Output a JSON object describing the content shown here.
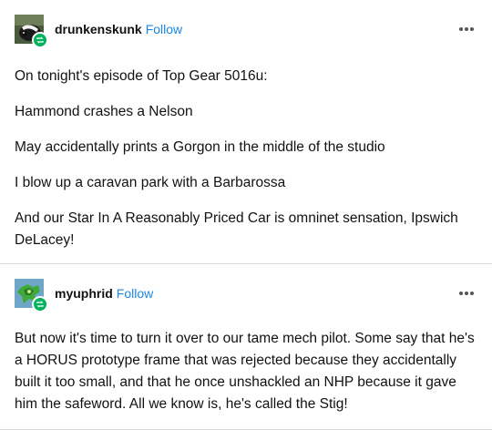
{
  "posts": [
    {
      "username": "drunkenskunk",
      "follow_label": "Follow",
      "avatar_icon": "skunk-avatar",
      "badge_icon": "reblog-icon",
      "more_icon": "more-options-icon",
      "paragraphs": [
        "On tonight's episode of Top Gear 5016u:",
        "Hammond crashes a Nelson",
        "May accidentally prints a Gorgon in the middle of the studio",
        "I blow up a caravan park with a Barbarossa",
        "And our Star In A Reasonably Priced Car is omninet sensation, Ipswich DeLacey!"
      ]
    },
    {
      "username": "myuphrid",
      "follow_label": "Follow",
      "avatar_icon": "green-mech-avatar",
      "badge_icon": "reblog-icon",
      "more_icon": "more-options-icon",
      "paragraphs": [
        "But now it's time to turn it over to our tame mech pilot. Some say that he's a HORUS prototype frame that was rejected because they accidentally built it too small, and that he once unshackled an NHP because it gave him the safeword. All we know is, he's called the Stig!"
      ]
    }
  ],
  "colors": {
    "follow": "#1d87e6",
    "badge": "#00b35c",
    "text": "#121212",
    "divider": "#d9d9d9"
  }
}
